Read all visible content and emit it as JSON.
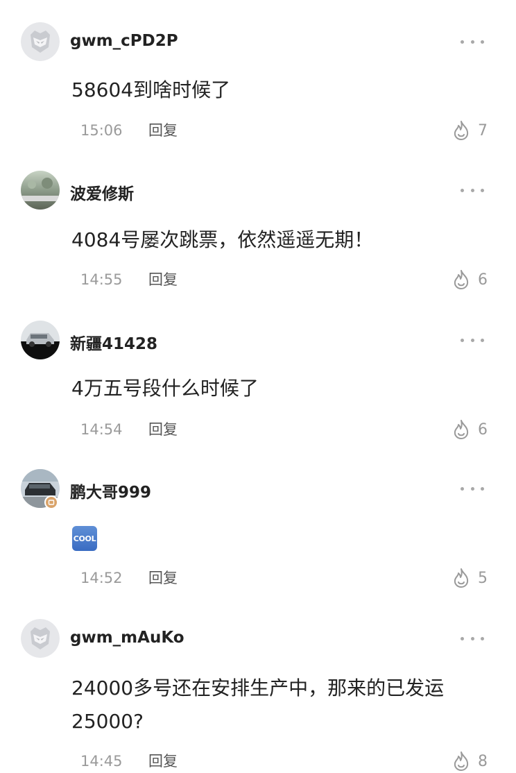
{
  "comments": [
    {
      "username": "gwm_cPD2P",
      "text_lines": [
        "58604到啥时候了"
      ],
      "time": "15:06",
      "reply_label": "回复",
      "likes": "7",
      "avatar_icon": "mech-helmet-default-avatar"
    },
    {
      "username": "波爱修斯",
      "text_lines": [
        "4084号屡次跳票，依然遥遥无期！"
      ],
      "time": "14:55",
      "reply_label": "回复",
      "likes": "6",
      "avatar_icon": "photo-avatar"
    },
    {
      "username": "新疆41428",
      "text_lines": [
        "4万五号段什么时候了"
      ],
      "time": "14:54",
      "reply_label": "回复",
      "likes": "6",
      "avatar_icon": "car-photo-avatar"
    },
    {
      "username": "鹏大哥999",
      "emoji": "COOL",
      "time": "14:52",
      "reply_label": "回复",
      "likes": "5",
      "avatar_icon": "car-photo-avatar"
    },
    {
      "username": "gwm_mAuKo",
      "text_lines": [
        "24000多号还在安排生产中，那来的已发运",
        "25000?"
      ],
      "time": "14:45",
      "reply_label": "回复",
      "likes": "8",
      "avatar_icon": "mech-helmet-default-avatar"
    }
  ],
  "colors": {
    "username": "#222222",
    "text": "#222222",
    "meta": "#9a9a9a",
    "reply": "#555555",
    "dots": "#a8a8a8"
  }
}
